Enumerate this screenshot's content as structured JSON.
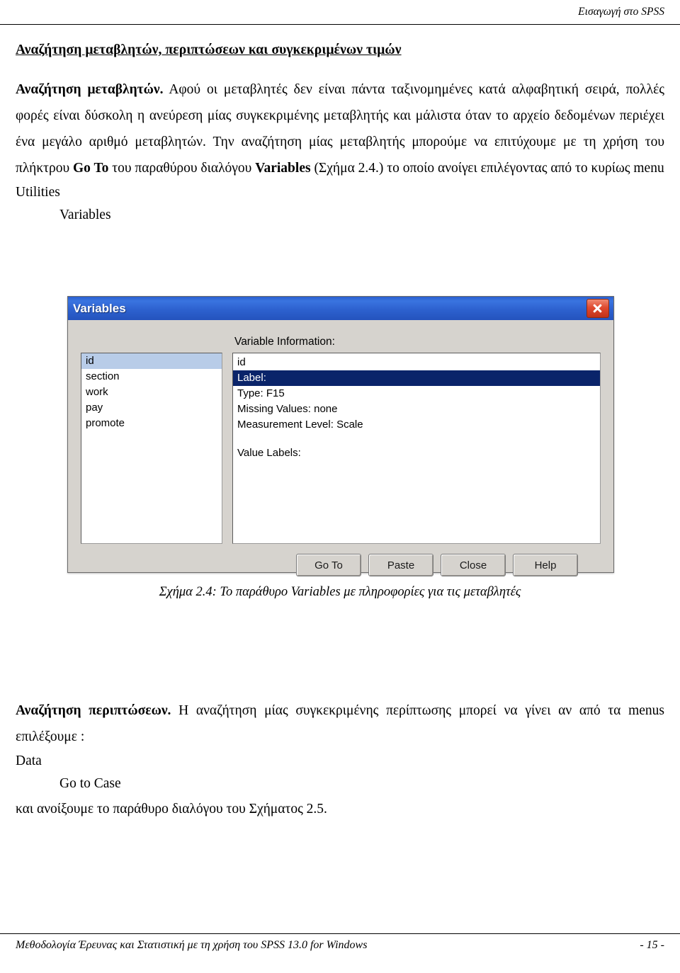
{
  "header": {
    "running_title": "Εισαγωγή στο SPSS"
  },
  "section": {
    "title": "Αναζήτηση μεταβλητών, περιπτώσεων και συγκεκριμένων τιμών",
    "para1_lead": "Αναζήτηση μεταβλητών.",
    "para1_rest": " Αφού οι μεταβλητές δεν είναι πάντα ταξινομημένες κατά αλφαβητική σειρά, πολλές φορές είναι δύσκολη η ανεύρεση μίας συγκεκριμένης μεταβλητής και μάλιστα όταν το αρχείο δεδομένων περιέχει ένα μεγάλο αριθμό μεταβλητών. Την αναζήτηση μίας μεταβλητής μπορούμε να επιτύχουμε με τη χρήση του πλήκτρου ",
    "para1_go_to": "Go To",
    "para1_rest2": " του παραθύρου διαλόγου ",
    "para1_variables": "Variables",
    "para1_rest3": " (Σχήμα 2.4.) το οποίο ανοίγει επιλέγοντας από το κυρίως menu",
    "menu1": "Utilities",
    "menu2": "Variables"
  },
  "dialog": {
    "title": "Variables",
    "close_tooltip": "Close",
    "variable_list": [
      {
        "name": "id",
        "selected": true
      },
      {
        "name": "section",
        "selected": false
      },
      {
        "name": "work",
        "selected": false
      },
      {
        "name": "pay",
        "selected": false
      },
      {
        "name": "promote",
        "selected": false
      }
    ],
    "info_label": "Variable Information:",
    "info_lines": [
      {
        "text": "id",
        "selected": false
      },
      {
        "text": "Label:",
        "selected": true
      },
      {
        "text": "Type:  F15",
        "selected": false
      },
      {
        "text": "Missing Values:   none",
        "selected": false
      },
      {
        "text": "Measurement Level:  Scale",
        "selected": false
      }
    ],
    "value_labels_label": "Value Labels:",
    "buttons": [
      "Go To",
      "Paste",
      "Close",
      "Help"
    ]
  },
  "figure": {
    "caption": "Σχήμα 2.4: Το παράθυρο Variables με πληροφορίες για τις μεταβλητές"
  },
  "section2": {
    "para_lead": "Αναζήτηση περιπτώσεων.",
    "para_rest": " Η αναζήτηση μίας συγκεκριμένης περίπτωσης μπορεί να γίνει αν από τα menus επιλέξουμε :",
    "menu1": "Data",
    "menu2": "Go to Case",
    "closing": "και ανοίξουμε το παράθυρο διαλόγου του Σχήματος 2.5."
  },
  "footer": {
    "left": "Μεθοδολογία Έρευνας και Στατιστική με τη χρήση του SPSS 13.0 for Windows",
    "right": "- 15 -"
  }
}
